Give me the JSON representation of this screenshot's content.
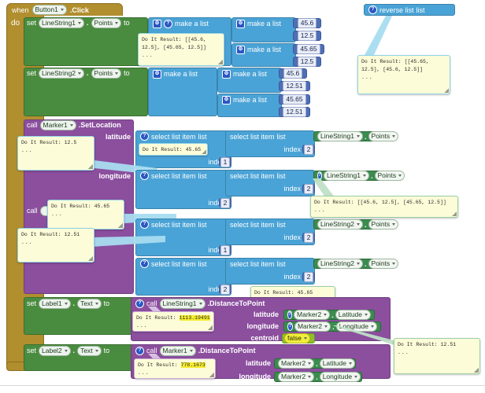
{
  "meta": {
    "app": "MIT App Inventor Blocks Editor",
    "canvas_bg": "#ffffff"
  },
  "colors": {
    "event_gold": "#b18e2e",
    "setter_green": "#4a8c3f",
    "component_green": "#3b8c4f",
    "method_purple": "#8b4f9e",
    "list_blue": "#4aa3d6",
    "number_blue": "#4f6fb5",
    "balloon_yellow": "#fdfcd8",
    "highlight_yellow": "#f5ec2e"
  },
  "event": {
    "when": "when",
    "component": "Button1",
    "method": ".Click",
    "do": "do"
  },
  "labels": {
    "set": "set",
    "to": "to",
    "call": "call",
    "make_a_list": "make a list",
    "select_list_item": "select list item",
    "list": "list",
    "index": "index",
    "latitude": "latitude",
    "longitude": "longitude",
    "centroid": "centroid",
    "reverse_list": "reverse list",
    "points": "Points",
    "text": "Text",
    "dot": "."
  },
  "statements": {
    "set_linestring1_points": {
      "set": "set",
      "component": "LineString1",
      "property": "Points",
      "to": "to"
    },
    "set_linestring2_points": {
      "set": "set",
      "component": "LineString2",
      "property": "Points",
      "to": "to"
    },
    "call_marker1_setlocation": {
      "call": "call",
      "component": "Marker1",
      "method": ".SetLocation",
      "latitude": "latitude",
      "longitude": "longitude"
    },
    "call_marker2_setlocation": {
      "call": "call",
      "component": "",
      "method": ""
    },
    "set_label1_text": {
      "set": "set",
      "component": "Label1",
      "property": "Text",
      "to": "to"
    },
    "set_label2_text": {
      "set": "set",
      "component": "Label2",
      "property": "Text",
      "to": "to"
    }
  },
  "linestring1_points": {
    "pair1": {
      "lat": "45.6",
      "lon": "12.5"
    },
    "pair2": {
      "lat": "45.65",
      "lon": "12.5"
    }
  },
  "linestring2_points": {
    "pair1": {
      "lat": "45.6",
      "lon": "12.51"
    },
    "pair2": {
      "lat": "45.65",
      "lon": "12.51"
    }
  },
  "selects": {
    "s1": {
      "label": "select list item",
      "list": "list",
      "index_label": "index",
      "index": "1",
      "inner_index": "2",
      "component": "LineString1",
      "property": "Points"
    },
    "s2": {
      "label": "select list item",
      "list": "list",
      "index_label": "index",
      "index": "2",
      "inner_index": "2",
      "component": "LineString1",
      "property": "Points"
    },
    "s3": {
      "label": "select list item",
      "list": "list",
      "index_label": "index",
      "index": "1",
      "inner_index": "2",
      "component": "LineString2",
      "property": "Points"
    },
    "s4": {
      "label": "select list item",
      "list": "list",
      "index_label": "index",
      "index": "2",
      "inner_index": "2",
      "component": "LineString2",
      "property": "Points"
    }
  },
  "distance1": {
    "call": "call",
    "component": "LineString1",
    "method": ".DistanceToPoint",
    "latitude_label": "latitude",
    "longitude_label": "longitude",
    "centroid_label": "centroid",
    "latitude_component": "Marker2",
    "latitude_property": "Latitude",
    "longitude_component": "Marker2",
    "longitude_property": "Longitude",
    "centroid_value": "false"
  },
  "distance2": {
    "call": "call",
    "component": "Marker1",
    "method": ".DistanceToPoint",
    "latitude_label": "latitude",
    "longitude_label": "longitude",
    "latitude_component": "Marker2",
    "latitude_property": "Latitude",
    "longitude_component": "Marker2",
    "longitude_property": "Longitude"
  },
  "reverse_block": {
    "label": "reverse list",
    "socket": "list"
  },
  "results": {
    "prefix": "Do It Result:",
    "ellipsis": "...",
    "r_linestring1_points": "[[45.6, 12.5], [45.65, 12.5]]",
    "r_reverse": "[[45.65, 12.5], [45.6, 12.5]]",
    "r_lat_1": "12.5",
    "r_select_4565": "45.65",
    "r_linestring1_points_2": "[[45.6, 12.5], [45.65, 12.5]]",
    "r_call2_4565": "45.65",
    "r_lon_1251": "12.51",
    "r_select_4565_b": "45.65",
    "r_distance1": "1113.19491",
    "r_distance2": "778.1673",
    "r_marker2_lon": "12.51"
  }
}
